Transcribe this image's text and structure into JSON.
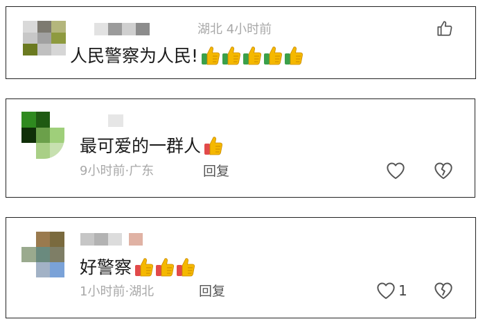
{
  "comments": [
    {
      "location_time": "湖北 4小时前",
      "text": "人民警察为人民!",
      "emoji": [
        "thumbs-up-icon",
        "thumbs-up-icon",
        "thumbs-up-icon",
        "thumbs-up-icon",
        "thumbs-up-icon"
      ]
    },
    {
      "text": "最可爱的一群人",
      "emoji": [
        "thumbs-up-icon"
      ],
      "time": "9小时前",
      "separator": "·",
      "location": "广东",
      "reply_label": "回复"
    },
    {
      "text": "好警察",
      "emoji": [
        "thumbs-up-icon",
        "thumbs-up-icon",
        "thumbs-up-icon"
      ],
      "time": "1小时前",
      "separator": "·",
      "location": "湖北",
      "reply_label": "回复",
      "like_count": "1"
    }
  ],
  "colors": {
    "meta_text": "#a8a8a8",
    "comment_text": "#1a1a1a",
    "card_border": "#222222",
    "thumb_yellow": "#f5b800",
    "cuff_green": "#3aa04a",
    "cuff_red": "#e24a4a"
  }
}
